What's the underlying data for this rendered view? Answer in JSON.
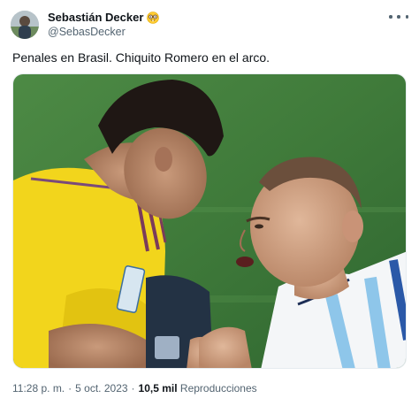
{
  "author": {
    "display_name": "Sebastián Decker",
    "handle": "@SebasDecker",
    "badge_emoji": "nerd-face-emoji"
  },
  "tweet": {
    "text": "Penales en Brasil. Chiquito Romero en el arco."
  },
  "meta": {
    "time": "11:28 p. m.",
    "separator": "·",
    "date": "5 oct. 2023",
    "views_count": "10,5 mil",
    "views_label": "Reproducciones"
  },
  "icons": {
    "more": "more-horizontal-icon"
  },
  "colors": {
    "text_primary": "#0f1419",
    "text_secondary": "#536471",
    "pitch_green": "#3f7a3a",
    "goalkeeper_yellow": "#f2d51c",
    "argentina_sky_blue": "#8ec6ea"
  }
}
